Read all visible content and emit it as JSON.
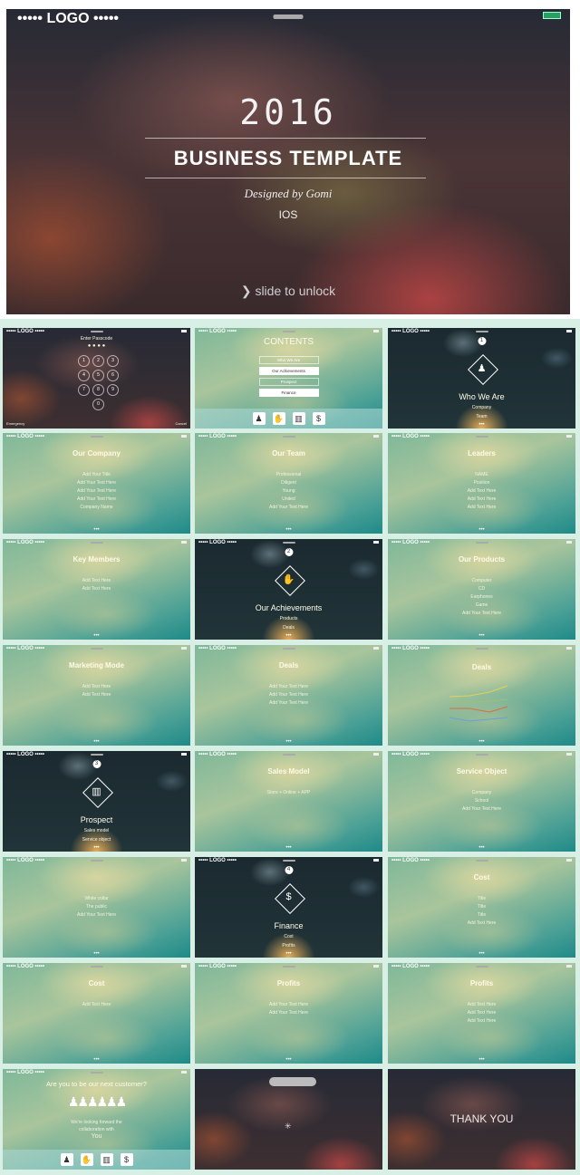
{
  "hero": {
    "logo": "••••• LOGO •••••",
    "year": "2016",
    "title": "BUSINESS  TEMPLATE",
    "designer": "Designed by Gomi",
    "platform": "IOS",
    "unlock": "❯ slide to unlock",
    "battery_color": "#2aa060"
  },
  "logo_small": "••••• LOGO •••••",
  "dots": "•••",
  "slides": [
    {
      "theme": "dark",
      "kind": "passcode",
      "lines": [
        "Enter Passcode",
        "● ● ● ●"
      ],
      "keys": [
        "1",
        "2",
        "3",
        "4",
        "5",
        "6",
        "7",
        "8",
        "9",
        "0"
      ],
      "footer_left": "Emergency",
      "footer_right": "Cancel"
    },
    {
      "theme": "teal",
      "kind": "contents",
      "title": "CONTENTS",
      "boxes": [
        "Who We Are",
        "Our Achievements",
        "Prospect",
        "Finance"
      ],
      "icons": [
        "people-icon",
        "handshake-icon",
        "chart-icon",
        "money-bag-icon"
      ]
    },
    {
      "theme": "night",
      "kind": "section",
      "badge": "1",
      "title": "Who We Are",
      "lines": [
        "Company",
        "Team"
      ],
      "icon": "people-icon"
    },
    {
      "theme": "teal",
      "kind": "content",
      "title": "Our Company",
      "lines": [
        "Add Your Title",
        "Add Your Text Here",
        "Add Your Text Here",
        "Add Your Text Here",
        "Company Name"
      ]
    },
    {
      "theme": "teal",
      "kind": "content",
      "title": "Our Team",
      "lines": [
        "Professional",
        "Diligent",
        "Young",
        "United",
        "Add Your Text Here"
      ]
    },
    {
      "theme": "teal",
      "kind": "content",
      "title": "Leaders",
      "lines": [
        "NAME",
        "Position",
        "Add Text Here",
        "Add Text Here",
        "Add Text Here"
      ]
    },
    {
      "theme": "teal",
      "kind": "content",
      "title": "Key Members",
      "lines": [
        "Add Text Here",
        "Add Text Here"
      ]
    },
    {
      "theme": "night",
      "kind": "section",
      "badge": "2",
      "title": "Our Achievements",
      "lines": [
        "Products",
        "Deals"
      ],
      "icon": "handshake-icon"
    },
    {
      "theme": "teal",
      "kind": "content",
      "title": "Our Products",
      "lines": [
        "Computer",
        "CD",
        "Earphones",
        "Game",
        "Add Your Text Here"
      ]
    },
    {
      "theme": "teal",
      "kind": "content",
      "title": "Marketing Mode",
      "lines": [
        "Add Text Here",
        "Add Text Here"
      ]
    },
    {
      "theme": "teal",
      "kind": "content",
      "title": "Deals",
      "lines": [
        "Add Your Text Here",
        "Add Your Text Here",
        "Add Your Text Here"
      ]
    },
    {
      "theme": "teal",
      "kind": "chart",
      "title": "Deals",
      "series_colors": [
        "#e8d050",
        "#e06a40",
        "#6aa0d8",
        "#a0c070"
      ]
    },
    {
      "theme": "night",
      "kind": "section",
      "badge": "3",
      "title": "Prospect",
      "lines": [
        "Sales model",
        "Service object"
      ],
      "icon": "chart-icon"
    },
    {
      "theme": "teal",
      "kind": "content",
      "title": "Sales Model",
      "lines": [
        "Store  +  Online  +  APP"
      ]
    },
    {
      "theme": "teal",
      "kind": "content",
      "title": "Service Object",
      "lines": [
        "Company",
        "School",
        "Add Your Text Here"
      ]
    },
    {
      "theme": "teal",
      "kind": "content",
      "title": "",
      "lines": [
        "White collar",
        "The public",
        "Add Your Text Here"
      ]
    },
    {
      "theme": "night",
      "kind": "section",
      "badge": "4",
      "title": "Finance",
      "lines": [
        "Cost",
        "Profits"
      ],
      "icon": "money-bag-icon"
    },
    {
      "theme": "teal",
      "kind": "content",
      "title": "Cost",
      "lines": [
        "Title",
        "Title",
        "Title",
        "Add Text Here"
      ]
    },
    {
      "theme": "teal",
      "kind": "content",
      "title": "Cost",
      "lines": [
        "Add Text Here"
      ]
    },
    {
      "theme": "teal",
      "kind": "content",
      "title": "Profits",
      "lines": [
        "Add Your Text Here",
        "Add Your Text Here"
      ]
    },
    {
      "theme": "teal",
      "kind": "content",
      "title": "Profits",
      "lines": [
        "Add Text Here",
        "Add Text Here",
        "Add Text Here"
      ]
    },
    {
      "theme": "teal",
      "kind": "closing",
      "title": "Are you to be our next customer?",
      "lines": [
        "We're looking forward the",
        "collaboration with",
        "You"
      ],
      "icons": [
        "people-icon",
        "handshake-icon",
        "chart-icon",
        "money-bag-icon"
      ]
    },
    {
      "theme": "dark",
      "kind": "loading",
      "lines": []
    },
    {
      "theme": "dark",
      "kind": "thanks",
      "title": "THANK YOU",
      "lines": []
    }
  ]
}
